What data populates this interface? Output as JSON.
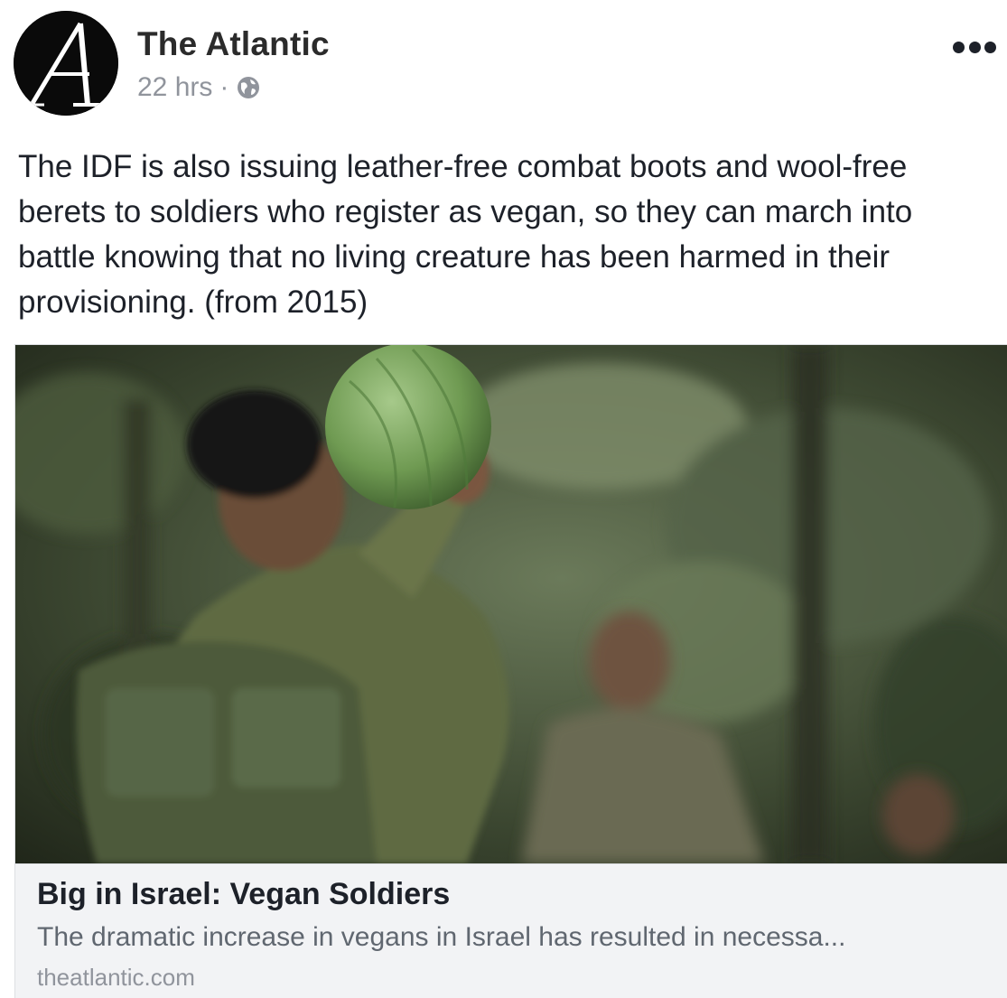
{
  "header": {
    "page_name": "The Atlantic",
    "time": "22 hrs",
    "separator": "·",
    "privacy_icon": "globe-icon",
    "avatar_icon": "atlantic-logo-icon",
    "more_icon": "more-options-icon"
  },
  "post": {
    "text": "The IDF is also issuing leather-free combat boots and wool-free berets to soldiers who register as vegan, so they can march into battle knowing that no living creature has been harmed in their provisioning. (from 2015)"
  },
  "link_card": {
    "title": "Big in Israel: Vegan Soldiers",
    "description": "The dramatic increase in vegans in Israel has resulted in necessa...",
    "domain": "theatlantic.com"
  },
  "colors": {
    "text_primary": "#1d2129",
    "text_secondary": "#90949c",
    "caption_bg": "#f2f3f5"
  }
}
